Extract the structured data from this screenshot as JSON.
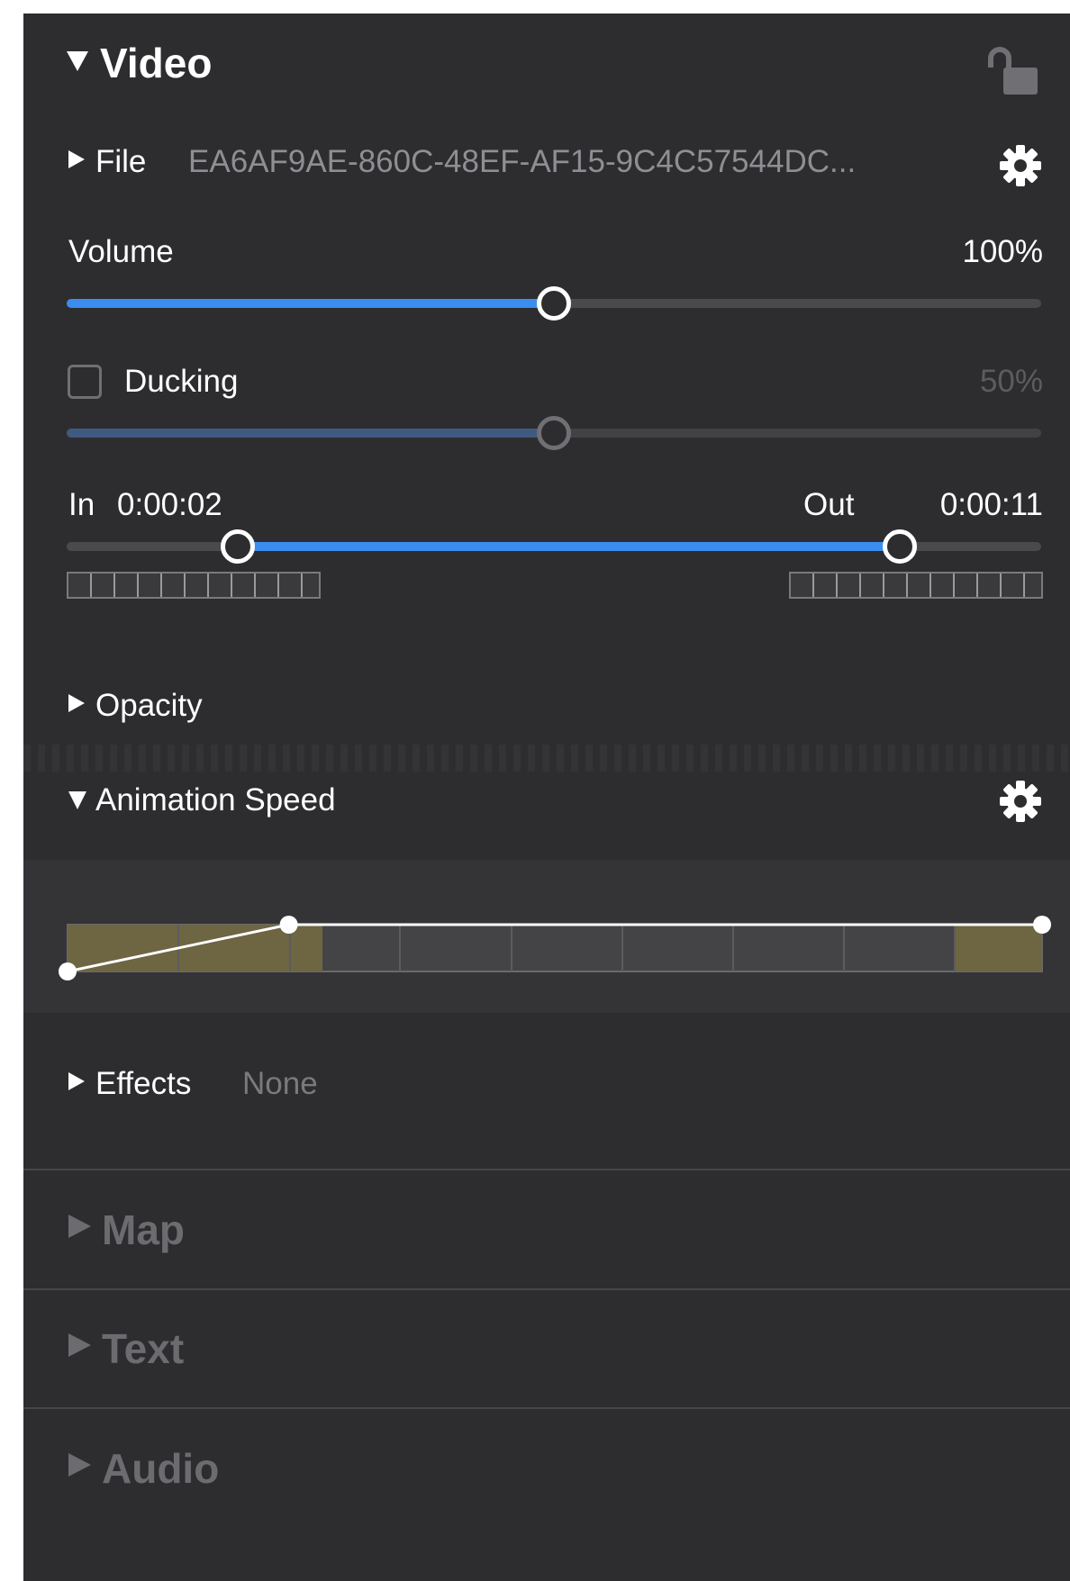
{
  "video": {
    "title": "Video",
    "lock_icon": "lock-open-icon",
    "file": {
      "label": "File",
      "value": "EA6AF9AE-860C-48EF-AF15-9C4C57544DC...",
      "settings_icon": "gear-icon"
    },
    "volume": {
      "label": "Volume",
      "value_text": "100%",
      "level": 0.5
    },
    "ducking": {
      "label": "Ducking",
      "checked": false,
      "value_text": "50%",
      "level": 0.5
    },
    "trim": {
      "in_label": "In",
      "in_value": "0:00:02",
      "out_label": "Out",
      "out_value": "0:00:11",
      "in_fraction": 0.176,
      "out_fraction": 0.855
    }
  },
  "opacity": {
    "label": "Opacity"
  },
  "animation_speed": {
    "label": "Animation Speed",
    "settings_icon": "gear-icon",
    "curve_points": [
      [
        0,
        0
      ],
      [
        0.227,
        1
      ],
      [
        1,
        1
      ]
    ]
  },
  "effects": {
    "label": "Effects",
    "value": "None"
  },
  "sections": [
    {
      "label": "Map"
    },
    {
      "label": "Text"
    },
    {
      "label": "Audio"
    }
  ],
  "colors": {
    "panel_bg": "#2d2d2f",
    "accent_blue": "#3b8df0",
    "speed_fill": "#6e6542"
  }
}
